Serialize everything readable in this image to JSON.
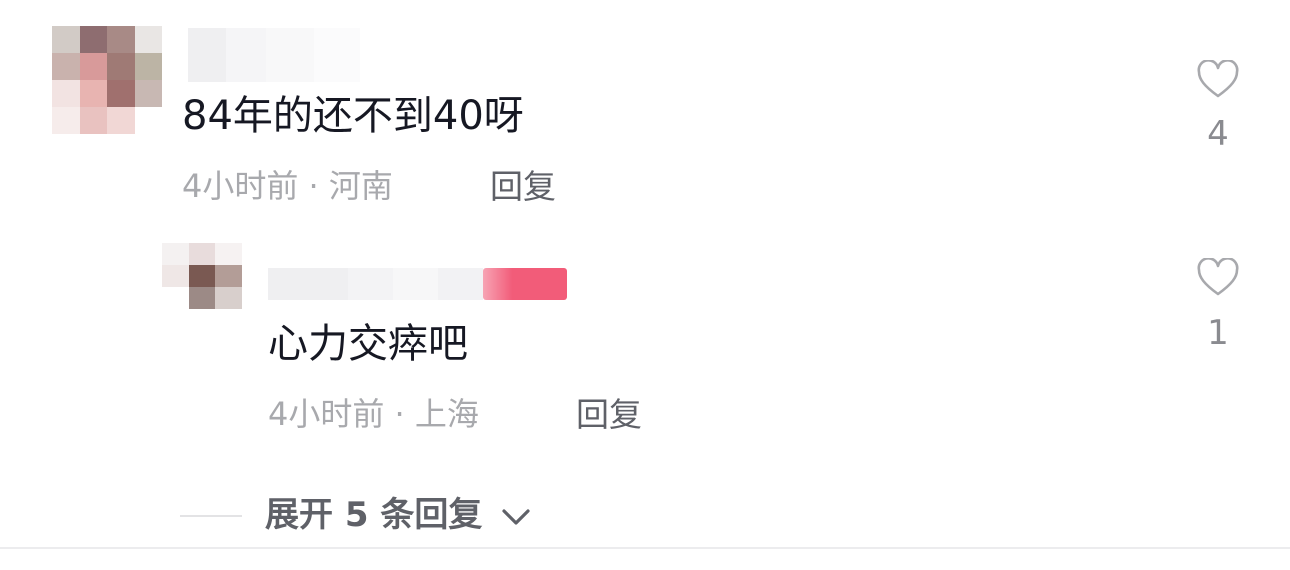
{
  "comments": [
    {
      "text": "84年的还不到40呀",
      "meta": "4小时前 · 河南",
      "reply_label": "回复",
      "like_count": "4",
      "like_icon": "heart-outline-icon"
    }
  ],
  "replies": [
    {
      "text": "心力交瘁吧",
      "meta": "4小时前 · 上海",
      "reply_label": "回复",
      "like_count": "1",
      "like_icon": "heart-outline-icon",
      "author_badge_color": "#f25c79"
    }
  ],
  "expand": {
    "label": "展开 5 条回复",
    "icon": "chevron-down-icon"
  },
  "colors": {
    "text_primary": "#161823",
    "text_meta": "#a8a9ad",
    "text_action": "#5f6168",
    "like_count": "#8a8b90"
  }
}
